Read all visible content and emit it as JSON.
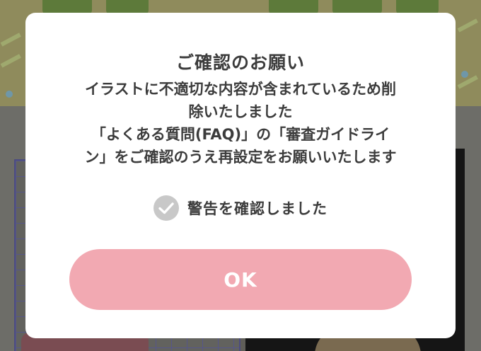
{
  "dialog": {
    "title": "ご確認のお願い",
    "message_lines": [
      "イラストに不適切な内容が含まれているため削",
      "除いたしました",
      "「よくある質問(FAQ)」の「審査ガイドライ",
      "ン」をご確認のうえ再設定をお願いいたします"
    ],
    "checkbox": {
      "label": "警告を確認しました",
      "icon": "check-icon",
      "checked": false
    },
    "ok_button_label": "OK"
  },
  "colors": {
    "dialog_background": "#ffffff",
    "text": "#3c3c3c",
    "ok_button": "#f2a9b2",
    "ok_button_text": "#ffffff",
    "checkbox_unchecked": "#c8c8c8",
    "overlay_tint": "#5f5e58"
  }
}
